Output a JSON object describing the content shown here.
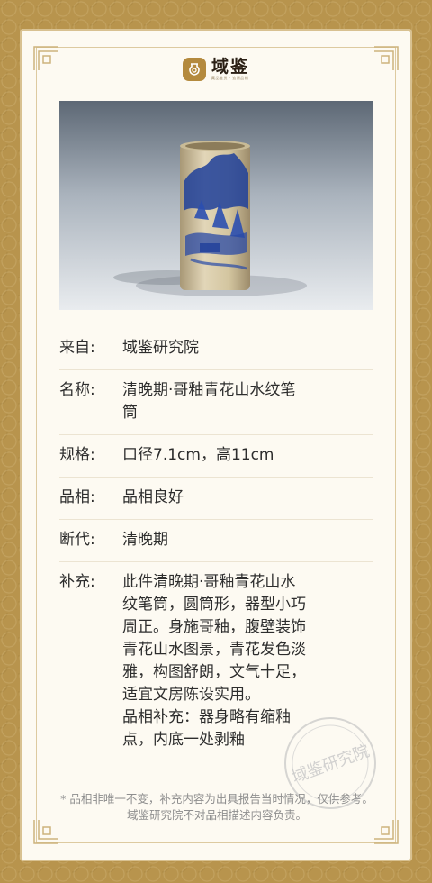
{
  "logo": {
    "name": "域鉴",
    "subtitle": "藏品鉴赏 · 追溯品相"
  },
  "photo": {
    "caption": "清晚期·哥釉青花山水纹笔筒",
    "icon": "brush-pot-photo"
  },
  "rows": [
    {
      "label": "来自:",
      "value": "域鉴研究院"
    },
    {
      "label": "名称:",
      "value": "清晚期·哥釉青花山水纹笔\n筒"
    },
    {
      "label": "规格:",
      "value": "口径7.1cm，高11cm"
    },
    {
      "label": "品相:",
      "value": "品相良好"
    },
    {
      "label": "断代:",
      "value": "清晚期"
    },
    {
      "label": "补充:",
      "value": "此件清晚期·哥釉青花山水\n纹笔筒，圆筒形，器型小巧\n周正。身施哥釉，腹壁装饰\n青花山水图景，青花发色淡\n雅，构图舒朗，文气十足，\n适宜文房陈设实用。\n品相补充：器身略有缩釉\n点，内底一处剥釉"
    }
  ],
  "note": "* 品相非唯一不变，补充内容为出具报告当时情况，仅供参考。域鉴研究院不对品相描述内容负责。",
  "seal": {
    "text": "域鉴研究院"
  },
  "colors": {
    "border_gold": "#b8944d",
    "card_bg": "#fdfaf2",
    "accent": "#b48a3e",
    "text": "#2d2d2d",
    "note": "#8e8e8e"
  }
}
